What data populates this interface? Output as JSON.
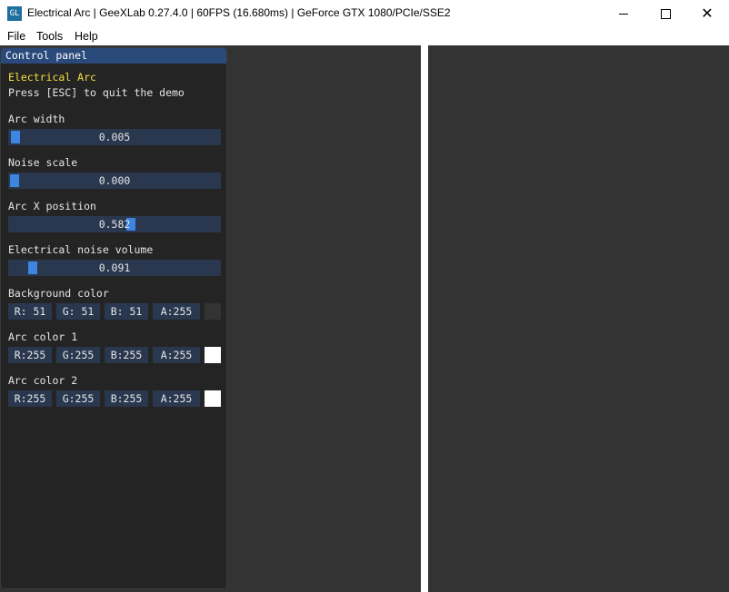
{
  "window": {
    "title": "Electrical Arc | GeeXLab 0.27.4.0 | 60FPS (16.680ms) | GeForce GTX 1080/PCIe/SSE2",
    "icon_text": "GL",
    "minimize_icon": "minimize-icon",
    "maximize_icon": "maximize-icon",
    "close_icon": "close-icon",
    "close_glyph": "✕"
  },
  "menubar": {
    "items": [
      "File",
      "Tools",
      "Help"
    ]
  },
  "panel": {
    "title": "Control panel",
    "demo_title": "Electrical Arc",
    "instructions": "Press [ESC] to quit the demo",
    "accent_color": "#3d85e0",
    "title_color": "#f2e041",
    "sliders": [
      {
        "label": "Arc width",
        "value": "0.005",
        "fraction": 0.005
      },
      {
        "label": "Noise scale",
        "value": "0.000",
        "fraction": 0.0
      },
      {
        "label": "Arc X position",
        "value": "0.582",
        "fraction": 0.582
      },
      {
        "label": "Electrical noise volume",
        "value": "0.091",
        "fraction": 0.091
      }
    ],
    "colors": [
      {
        "label": "Background color",
        "r": "R: 51",
        "g": "G: 51",
        "b": "B: 51",
        "a": "A:255",
        "swatch": "#333333"
      },
      {
        "label": "Arc color 1",
        "r": "R:255",
        "g": "G:255",
        "b": "B:255",
        "a": "A:255",
        "swatch": "#ffffff"
      },
      {
        "label": "Arc color 2",
        "r": "R:255",
        "g": "G:255",
        "b": "B:255",
        "a": "A:255",
        "swatch": "#ffffff"
      }
    ]
  },
  "viewport": {
    "background": "#333333",
    "arc_color": "#ffffff"
  }
}
